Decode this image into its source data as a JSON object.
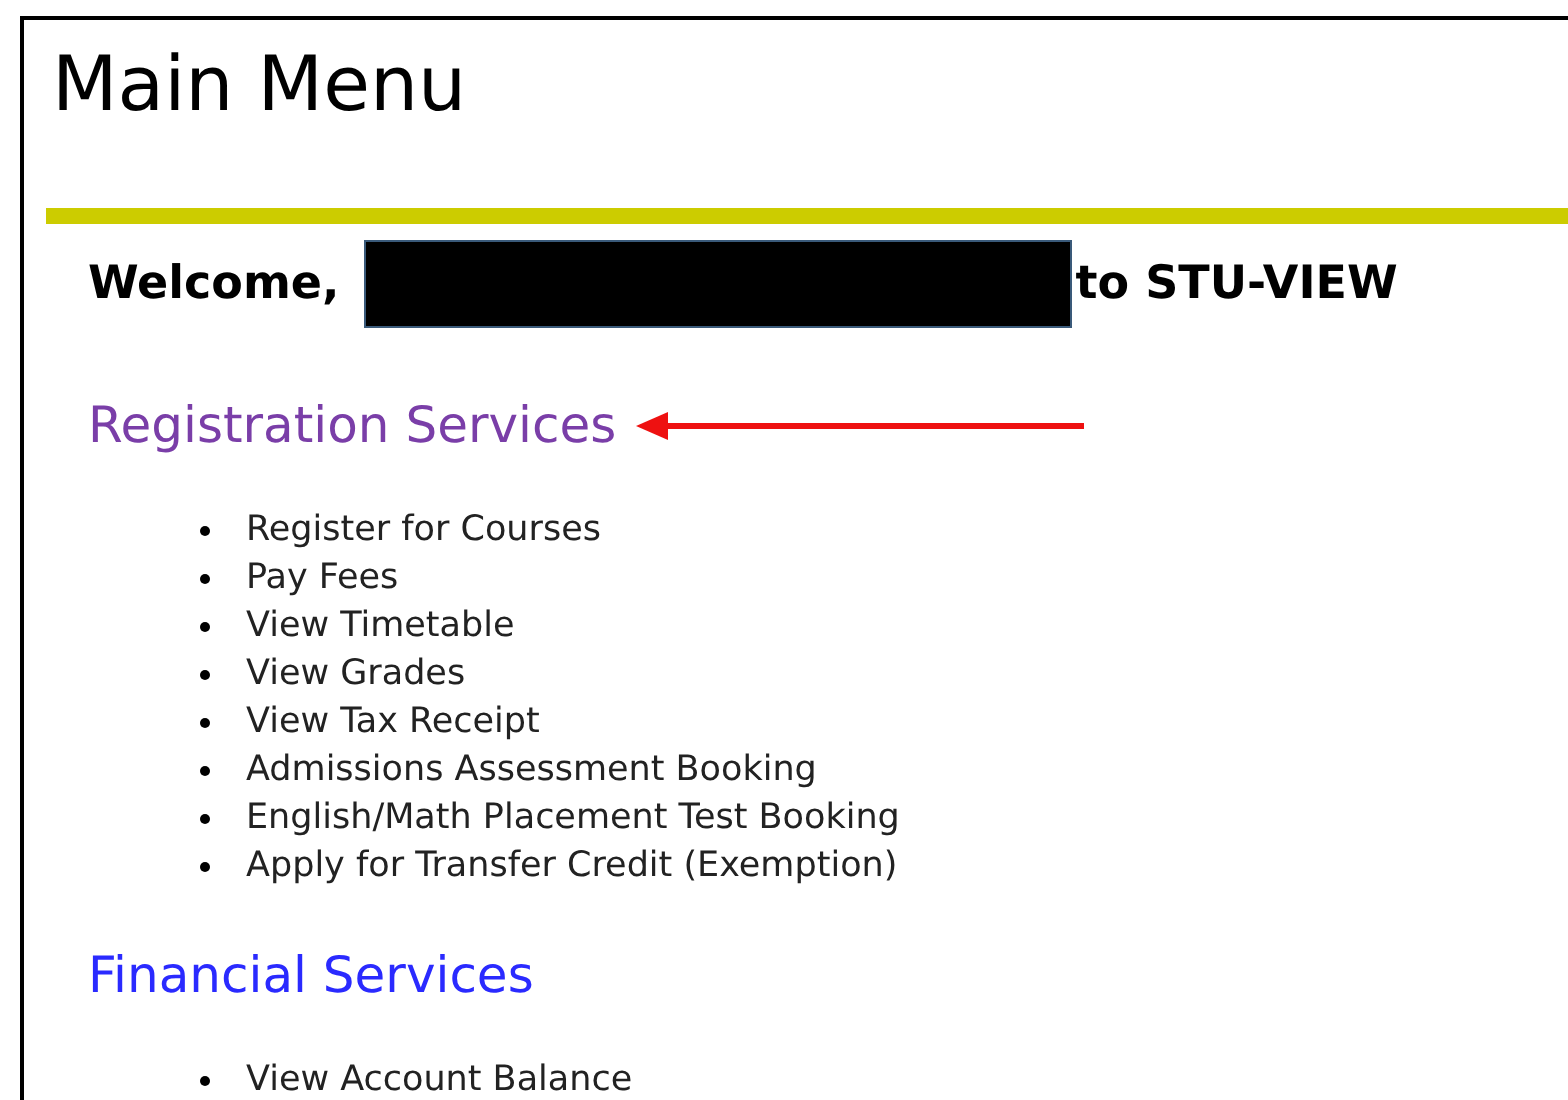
{
  "page_title": "Main Menu",
  "welcome": {
    "greeting": "Welcome,",
    "rest": "to STU-VIEW"
  },
  "sections": [
    {
      "title": "Registration Services",
      "visited": true,
      "annotated": true,
      "items": [
        "Register for Courses",
        "Pay Fees",
        "View Timetable",
        "View Grades",
        "View Tax Receipt",
        "Admissions Assessment Booking",
        "English/Math Placement Test Booking",
        "Apply for Transfer Credit (Exemption)"
      ]
    },
    {
      "title": "Financial Services",
      "visited": false,
      "annotated": false,
      "items": [
        "View Account Balance"
      ]
    }
  ]
}
